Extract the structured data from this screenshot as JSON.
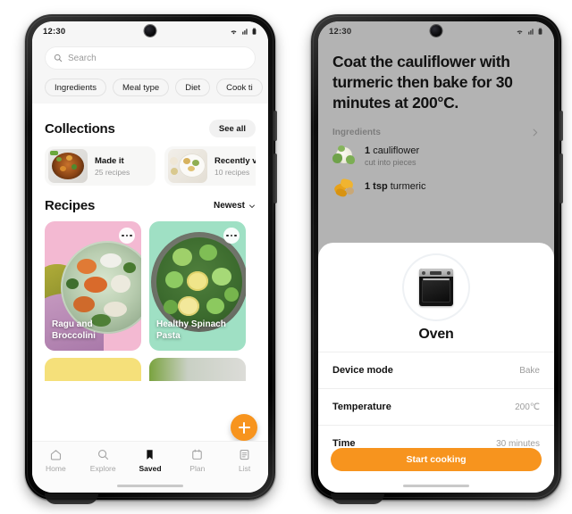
{
  "left_phone": {
    "status_bar": {
      "time": "12:30",
      "icons": [
        "wifi-icon",
        "signal-icon",
        "battery-icon"
      ]
    },
    "search": {
      "placeholder": "Search",
      "icon": "search-icon"
    },
    "filter_chips": [
      "Ingredients",
      "Meal type",
      "Diet",
      "Cook ti"
    ],
    "collections": {
      "title": "Collections",
      "see_all": "See all",
      "items": [
        {
          "title": "Made it",
          "subtitle": "25 recipes"
        },
        {
          "title": "Recently view",
          "subtitle": "10 recipes"
        }
      ]
    },
    "recipes": {
      "title": "Recipes",
      "sort_label": "Newest",
      "sort_icon": "chevron-down-icon",
      "cards": [
        {
          "title": "Ragu and Broccolini",
          "bg": "#f3b9d2",
          "menu_icon": "more-options-icon"
        },
        {
          "title": "Healthy Spinach Pasta",
          "bg": "#9fe0c4",
          "menu_icon": "more-options-icon"
        }
      ],
      "next_row": [
        {
          "bg": "#f5e07a"
        },
        {
          "bg": "#cfd6c9"
        }
      ]
    },
    "fab": {
      "icon": "plus-icon",
      "color": "#f7941e"
    },
    "bottom_nav": [
      {
        "label": "Home",
        "icon": "home-icon",
        "active": false
      },
      {
        "label": "Explore",
        "icon": "search-icon",
        "active": false
      },
      {
        "label": "Saved",
        "icon": "bookmark-icon",
        "active": true
      },
      {
        "label": "Plan",
        "icon": "calendar-icon",
        "active": false
      },
      {
        "label": "List",
        "icon": "list-icon",
        "active": false
      }
    ]
  },
  "right_phone": {
    "status_bar": {
      "time": "12:30",
      "icons": [
        "wifi-icon",
        "signal-icon",
        "battery-icon"
      ]
    },
    "step_text": "Coat the cauliflower with turmeric then bake for 30 minutes at 200°C.",
    "ingredients": {
      "header": "Ingredients",
      "chevron_icon": "chevron-right-icon",
      "items": [
        {
          "amount": "1",
          "name": "cauliflower",
          "note": "cut into pieces",
          "icon": "cauliflower-icon"
        },
        {
          "amount": "1 tsp",
          "name": "turmeric",
          "note": "",
          "icon": "turmeric-icon"
        }
      ]
    },
    "device_sheet": {
      "device_icon": "oven-icon",
      "device_name": "Oven",
      "settings": [
        {
          "key": "Device mode",
          "value": "Bake"
        },
        {
          "key": "Temperature",
          "value": "200℃"
        },
        {
          "key": "Time",
          "value": "30 minutes"
        }
      ],
      "cta_label": "Start cooking",
      "cta_color": "#f7941e"
    }
  }
}
